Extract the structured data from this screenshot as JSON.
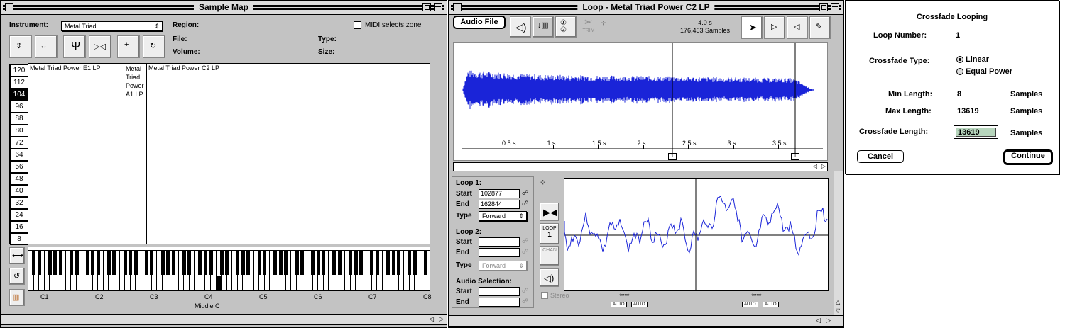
{
  "sample_map": {
    "title": "Sample Map",
    "instrument_label": "Instrument:",
    "instrument_value": "Metal Triad",
    "midi_label": "MIDI selects zone",
    "region_label": "Region:",
    "file_label": "File:",
    "volume_label": "Volume:",
    "type_label": "Type:",
    "size_label": "Size:",
    "velocities": [
      "120",
      "112",
      "104",
      "96",
      "88",
      "80",
      "72",
      "64",
      "56",
      "48",
      "40",
      "32",
      "24",
      "16",
      "8"
    ],
    "selected_velocity": "104",
    "zones": [
      {
        "label": "Metal Triad Power E1 LP"
      },
      {
        "label": "Metal Triad Power A1 LP"
      },
      {
        "label": "Metal Triad Power C2 LP"
      }
    ],
    "octaves": [
      "C1",
      "C2",
      "C3",
      "C4",
      "C5",
      "C6",
      "C7",
      "C8"
    ],
    "middle_c": "Middle C"
  },
  "loop": {
    "title": "Loop - Metal Triad Power C2 LP",
    "audio_file_label": "Audio File",
    "duration": "4.0 s",
    "samples": "176,463 Samples",
    "trim_label": "TRIM",
    "time_ticks": [
      "0.5 s",
      "1 s",
      "1.5 s",
      "2 s",
      "2.5 s",
      "3 s",
      "3.5 s"
    ],
    "loop_marker": "1",
    "loop1_label": "Loop 1:",
    "loop2_label": "Loop 2:",
    "start_label": "Start",
    "end_label": "End",
    "type_label": "Type",
    "loop1_start": "102877",
    "loop1_end": "162844",
    "loop1_type": "Forward",
    "loop2_type": "Forward",
    "audio_selection_label": "Audio Selection:",
    "loop_btn_label": "LOOP",
    "loop_btn_num": "1",
    "chan_label": "CHAN",
    "stereo_label": "Stereo",
    "auto_label": "AUTO"
  },
  "crossfade": {
    "title": "Crossfade Looping",
    "loop_number_label": "Loop Number:",
    "loop_number": "1",
    "type_label": "Crossfade Type:",
    "linear": "Linear",
    "equal_power": "Equal Power",
    "min_label": "Min Length:",
    "min_value": "8",
    "max_label": "Max Length:",
    "max_value": "13619",
    "length_label": "Crossfade Length:",
    "length_value": "13619",
    "samples_unit": "Samples",
    "cancel": "Cancel",
    "continue": "Continue"
  },
  "colors": {
    "waveform": "#1a24d8",
    "field_highlight": "#b7d6bd"
  }
}
